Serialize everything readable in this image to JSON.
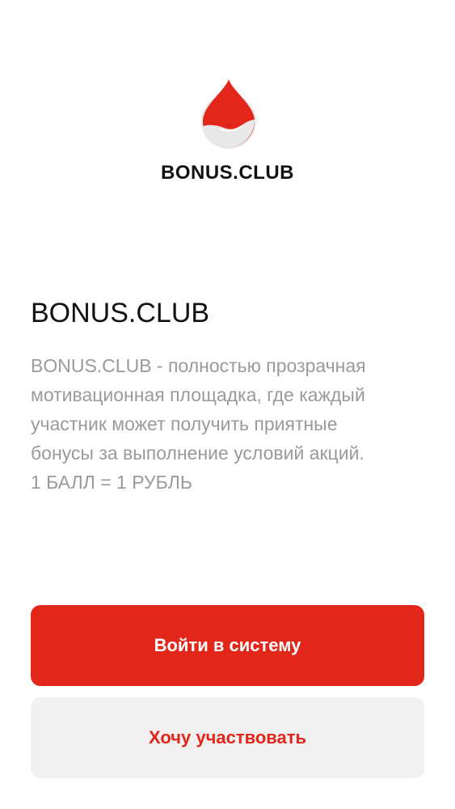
{
  "logo": {
    "icon": "blood-drop-hand-icon",
    "text": "BONUS.CLUB"
  },
  "content": {
    "title": "BONUS.CLUB",
    "description": "BONUS.CLUB - полностью прозрачная\nмотивационная площадка, где каждый\nучастник может получить приятные\nбонусы за выполнение условий акций.\n1 БАЛЛ = 1 РУБЛЬ"
  },
  "actions": {
    "login_label": "Войти в систему",
    "join_label": "Хочу участвовать"
  },
  "colors": {
    "accent": "#e3261a",
    "secondary_bg": "#f1f1f1",
    "text_primary": "#111111",
    "text_muted": "#9a9a9a"
  }
}
